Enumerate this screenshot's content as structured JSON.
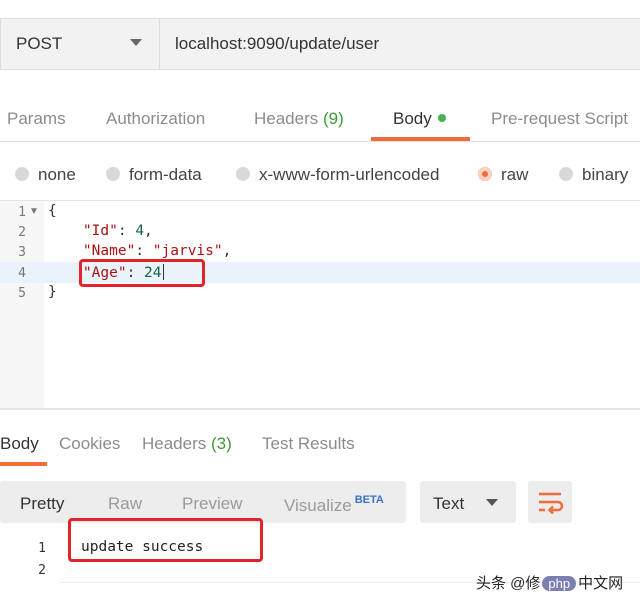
{
  "request": {
    "method": "POST",
    "url": "localhost:9090/update/user"
  },
  "request_tabs": [
    {
      "label": "Params"
    },
    {
      "label": "Authorization"
    },
    {
      "label": "Headers",
      "count": "(9)"
    },
    {
      "label": "Body"
    },
    {
      "label": "Pre-request Script"
    }
  ],
  "body_types": [
    "none",
    "form-data",
    "x-www-form-urlencoded",
    "raw",
    "binary"
  ],
  "editor": {
    "line_numbers": [
      "1",
      "2",
      "3",
      "4",
      "5"
    ],
    "line1": "{",
    "line2": {
      "key": "\"Id\"",
      "sep": ": ",
      "val": "4",
      "end": ","
    },
    "line3": {
      "key": "\"Name\"",
      "sep": ": ",
      "val": "\"jarvis\"",
      "end": ","
    },
    "line4": {
      "key": "\"Age\"",
      "sep": ": ",
      "val": "24"
    },
    "line5": "}"
  },
  "response_tabs": [
    {
      "label": "Body"
    },
    {
      "label": "Cookies"
    },
    {
      "label": "Headers",
      "count": "(3)"
    },
    {
      "label": "Test Results"
    }
  ],
  "view_modes": {
    "pretty": "Pretty",
    "raw": "Raw",
    "preview": "Preview",
    "visualize": "Visualize",
    "beta": "BETA"
  },
  "format": "Text",
  "response": {
    "line_numbers": [
      "1",
      "2"
    ],
    "line1": "update success"
  },
  "watermark": {
    "prefix": "头条 @修",
    "pill": "php",
    "suffix": "中文网"
  },
  "colors": {
    "accent": "#f26b3a",
    "highlight_box": "#e0242a",
    "status_green": "#3f9b3a"
  }
}
